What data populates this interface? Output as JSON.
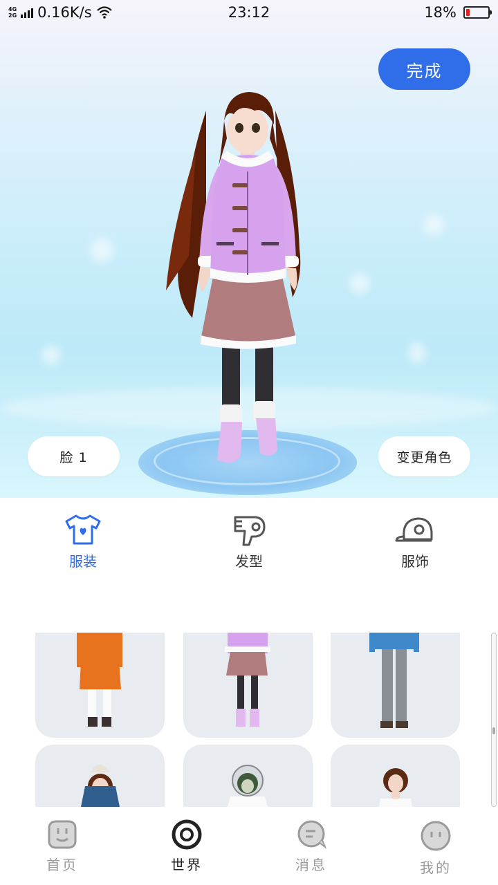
{
  "status_bar": {
    "net_type_top": "4G",
    "net_type_bottom": "2G",
    "speed": "0.16K/s",
    "time": "23:12",
    "battery": "18%",
    "battery_level": 0.18,
    "battery_color": "#e02020"
  },
  "stage": {
    "done_label": "完成",
    "face_label": "脸 1",
    "change_role_label": "变更角色"
  },
  "categories": [
    {
      "label": "服装",
      "icon": "tshirt-icon",
      "active": true
    },
    {
      "label": "发型",
      "icon": "hair-dryer-icon",
      "active": false
    },
    {
      "label": "服饰",
      "icon": "cap-icon",
      "active": false
    }
  ],
  "bottom_nav": [
    {
      "label": "首页",
      "icon": "home-face-icon",
      "active": false
    },
    {
      "label": "世界",
      "icon": "world-ring-icon",
      "active": true
    },
    {
      "label": "消息",
      "icon": "message-icon",
      "active": false
    },
    {
      "label": "我的",
      "icon": "profile-face-icon",
      "active": false
    }
  ],
  "colors": {
    "accent": "#2f6ee8",
    "tile_bg": "#e8ecf1",
    "inactive_text": "#9a9a9a"
  }
}
